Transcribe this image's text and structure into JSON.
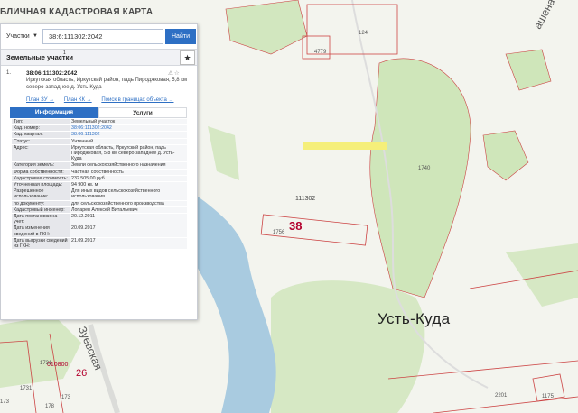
{
  "app": {
    "title": "БЛИЧНАЯ КАДАСТРОВАЯ КАРТА"
  },
  "search": {
    "type_label": "Участки",
    "value": "38:6:111302:2042",
    "button": "Найти"
  },
  "section": {
    "title": "Земельные участки",
    "count": "1"
  },
  "result": {
    "number": "1.",
    "cadastral_number": "38:06:111302:2042",
    "address": "Иркутская область, Иркутский район, падь Пироджковая, 5,8 км северо-западнее д. Усть-Куда",
    "links": [
      "План ЗУ →",
      "План КК →",
      "Поиск в границах объекта →"
    ]
  },
  "tabs": {
    "info": "Информация",
    "services": "Услуги"
  },
  "attributes": [
    {
      "key": "Тип:",
      "value": "Земельный участок"
    },
    {
      "key": "Кад. номер:",
      "value": "38:06:111302:2042"
    },
    {
      "key": "Кад. квартал:",
      "value": "38:06:111302"
    },
    {
      "key": "Статус:",
      "value": "Учтенный"
    },
    {
      "key": "Адрес:",
      "value": "Иркутская область, Иркутский район, падь Пироджковая, 5,8 км северо-западнее д. Усть-Куда"
    },
    {
      "key": "Категория земель:",
      "value": "Земли сельскохозяйственного назначения"
    },
    {
      "key": "Форма собственности:",
      "value": "Частная собственность"
    },
    {
      "key": "Кадастровая стоимость:",
      "value": "232 505,00 руб."
    },
    {
      "key": "Уточненная площадь:",
      "value": "94 900 кв. м"
    },
    {
      "key": "Разрешенное использование:",
      "value": "Для иных видов сельскохозяйственного использования"
    },
    {
      "key": "по документу:",
      "value": "для сельскохозяйственного производства"
    },
    {
      "key": "Кадастровый инженер:",
      "value": "Лопарев Алексей Витальевич"
    },
    {
      "key": "Дата постановки на учет:",
      "value": "20.12.2011"
    },
    {
      "key": "Дата изменения сведений в ГКН:",
      "value": "20.09.2017"
    },
    {
      "key": "Дата выгрузки сведений из ГКН:",
      "value": "21.09.2017"
    }
  ],
  "map_labels": {
    "town": "Усть-Куда",
    "quarter": "111302",
    "region_code": "38",
    "street": "Зуевская",
    "street_top": "ашена",
    "n_26": "26",
    "n_010800": "010800",
    "n_124": "124",
    "n_4779": "4779",
    "n_1740": "1740",
    "n_1756": "1756",
    "n_2201": "2201",
    "n_1175": "1175",
    "n_1731": "1731",
    "n_1731b": "1731",
    "n_173": "173",
    "n_178": "178",
    "n_173b": "173"
  }
}
